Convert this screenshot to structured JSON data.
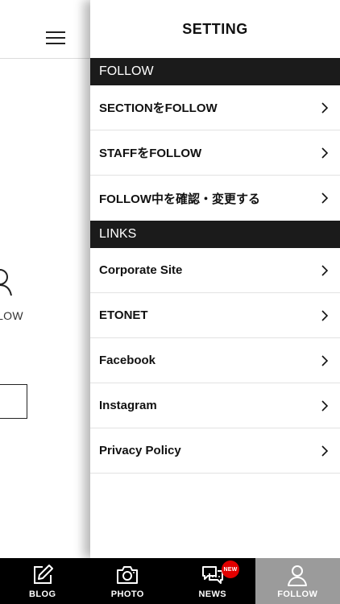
{
  "background_screen": {
    "follow_text": "LLOW"
  },
  "settings": {
    "title": "SETTING",
    "sections": [
      {
        "header": "FOLLOW",
        "items": [
          "SECTIONをFOLLOW",
          "STAFFをFOLLOW",
          "FOLLOW中を確認・変更する"
        ]
      },
      {
        "header": "LINKS",
        "items": [
          "Corporate Site",
          "ETONET",
          "Facebook",
          "Instagram",
          "Privacy Policy"
        ]
      }
    ]
  },
  "tabbar": {
    "tabs": [
      {
        "label": "BLOG",
        "icon": "pencil-edit-icon"
      },
      {
        "label": "PHOTO",
        "icon": "camera-icon"
      },
      {
        "label": "NEWS",
        "icon": "chat-bubbles-icon",
        "badge": "NEW"
      },
      {
        "label": "FOLLOW",
        "icon": "person-icon",
        "active": true
      }
    ],
    "active_tab": "FOLLOW",
    "active_color": "#9b9b9b",
    "badge_color": "#e10000"
  }
}
